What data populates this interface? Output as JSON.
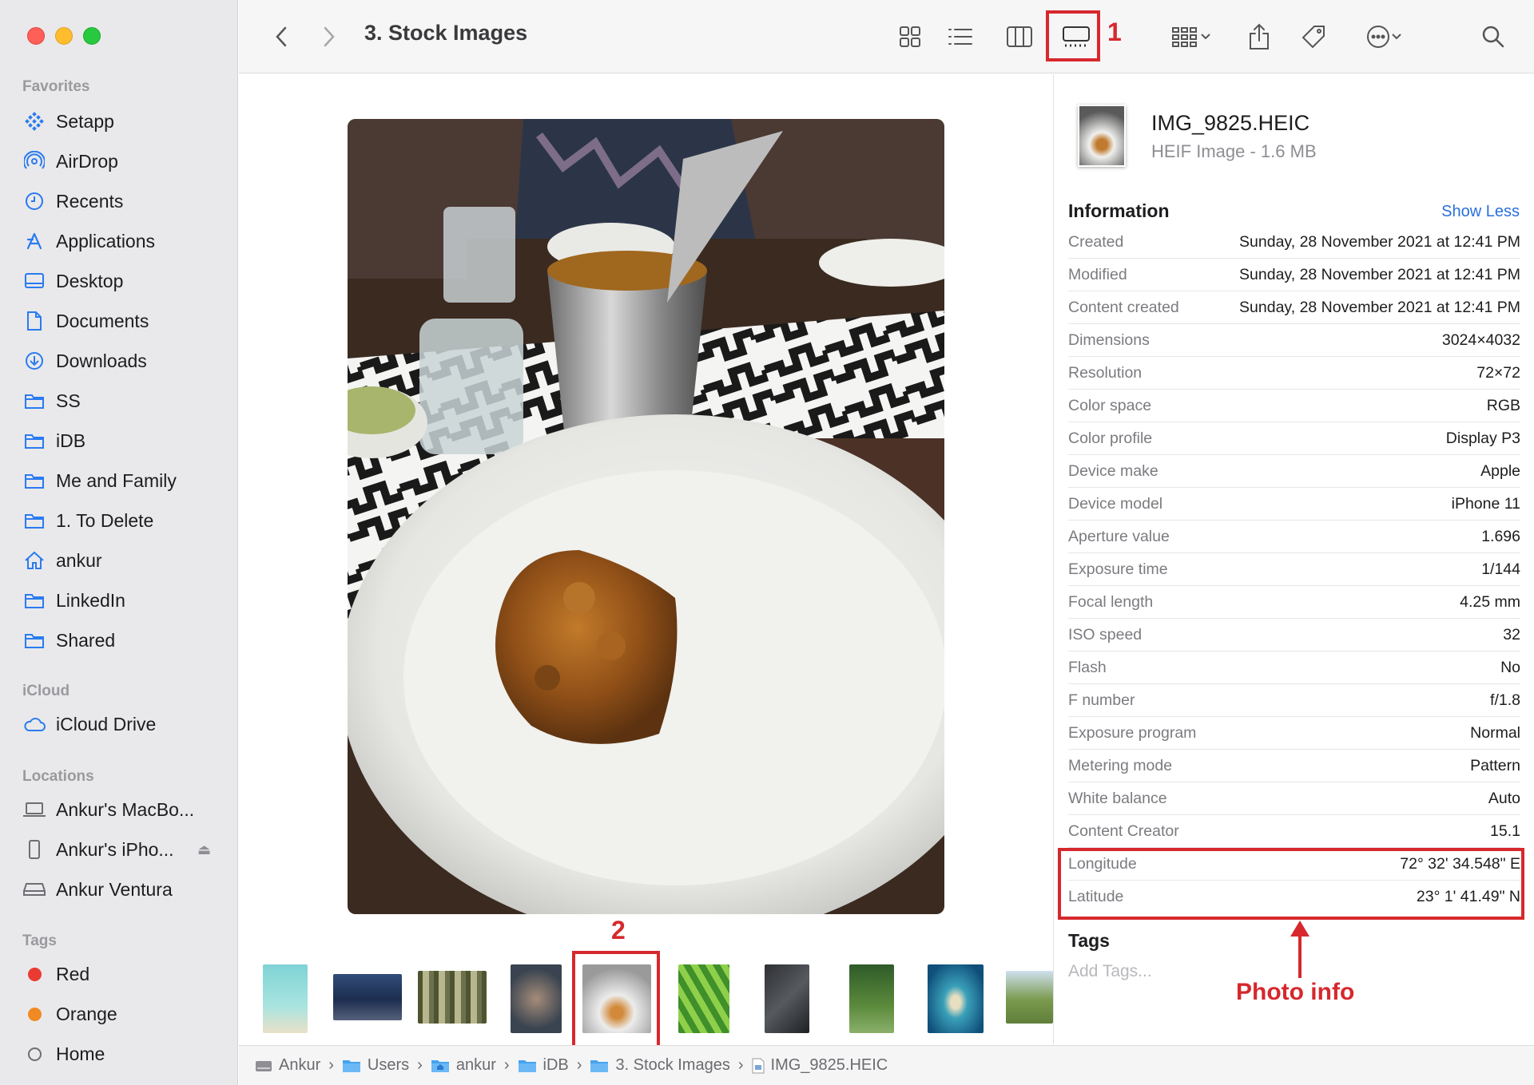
{
  "window": {
    "title": "3. Stock Images"
  },
  "sidebar": {
    "favorites_header": "Favorites",
    "favorites": [
      {
        "label": "Setapp",
        "icon": "setapp-icon"
      },
      {
        "label": "AirDrop",
        "icon": "airdrop-icon"
      },
      {
        "label": "Recents",
        "icon": "clock-icon"
      },
      {
        "label": "Applications",
        "icon": "applications-icon"
      },
      {
        "label": "Desktop",
        "icon": "desktop-icon"
      },
      {
        "label": "Documents",
        "icon": "document-icon"
      },
      {
        "label": "Downloads",
        "icon": "download-icon"
      },
      {
        "label": "SS",
        "icon": "folder-icon"
      },
      {
        "label": "iDB",
        "icon": "folder-icon"
      },
      {
        "label": "Me and Family",
        "icon": "folder-icon"
      },
      {
        "label": "1. To Delete",
        "icon": "folder-icon"
      },
      {
        "label": "ankur",
        "icon": "home-icon"
      },
      {
        "label": "LinkedIn",
        "icon": "folder-icon"
      },
      {
        "label": "Shared",
        "icon": "folder-icon"
      }
    ],
    "icloud_header": "iCloud",
    "icloud": [
      {
        "label": "iCloud Drive",
        "icon": "cloud-icon"
      }
    ],
    "locations_header": "Locations",
    "locations": [
      {
        "label": "Ankur's MacBo...",
        "icon": "laptop-icon"
      },
      {
        "label": "Ankur's iPho...",
        "icon": "iphone-icon"
      },
      {
        "label": "Ankur Ventura",
        "icon": "drive-icon"
      }
    ],
    "tags_header": "Tags",
    "tags": [
      {
        "label": "Red",
        "color": "#ea3b32"
      },
      {
        "label": "Orange",
        "color": "#f08a24"
      },
      {
        "label": "Home",
        "color": "none"
      }
    ]
  },
  "annotations": {
    "num1": "1",
    "num2": "2",
    "photo_info": "Photo info"
  },
  "inspector": {
    "file_name": "IMG_9825.HEIC",
    "file_kind": "HEIF Image - 1.6 MB",
    "info_header": "Information",
    "show_less": "Show Less",
    "rows": [
      {
        "k": "Created",
        "v": "Sunday, 28 November 2021 at 12:41 PM"
      },
      {
        "k": "Modified",
        "v": "Sunday, 28 November 2021 at 12:41 PM"
      },
      {
        "k": "Content created",
        "v": "Sunday, 28 November 2021 at 12:41 PM"
      },
      {
        "k": "Dimensions",
        "v": "3024×4032"
      },
      {
        "k": "Resolution",
        "v": "72×72"
      },
      {
        "k": "Color space",
        "v": "RGB"
      },
      {
        "k": "Color profile",
        "v": "Display P3"
      },
      {
        "k": "Device make",
        "v": "Apple"
      },
      {
        "k": "Device model",
        "v": "iPhone 11"
      },
      {
        "k": "Aperture value",
        "v": "1.696"
      },
      {
        "k": "Exposure time",
        "v": "1/144"
      },
      {
        "k": "Focal length",
        "v": "4.25 mm"
      },
      {
        "k": "ISO speed",
        "v": "32"
      },
      {
        "k": "Flash",
        "v": "No"
      },
      {
        "k": "F number",
        "v": "f/1.8"
      },
      {
        "k": "Exposure program",
        "v": "Normal"
      },
      {
        "k": "Metering mode",
        "v": "Pattern"
      },
      {
        "k": "White balance",
        "v": "Auto"
      },
      {
        "k": "Content Creator",
        "v": "15.1"
      },
      {
        "k": "Longitude",
        "v": "72° 32' 34.548\" E"
      },
      {
        "k": "Latitude",
        "v": "23° 1' 41.49\" N"
      }
    ],
    "tags_header": "Tags",
    "tags_placeholder": "Add Tags..."
  },
  "pathbar": [
    {
      "label": "Ankur",
      "icon": "drive-icon"
    },
    {
      "label": "Users",
      "icon": "folder-icon"
    },
    {
      "label": "ankur",
      "icon": "home-folder-icon"
    },
    {
      "label": "iDB",
      "icon": "folder-icon"
    },
    {
      "label": "3. Stock Images",
      "icon": "folder-icon"
    },
    {
      "label": "IMG_9825.HEIC",
      "icon": "image-file-icon"
    }
  ]
}
